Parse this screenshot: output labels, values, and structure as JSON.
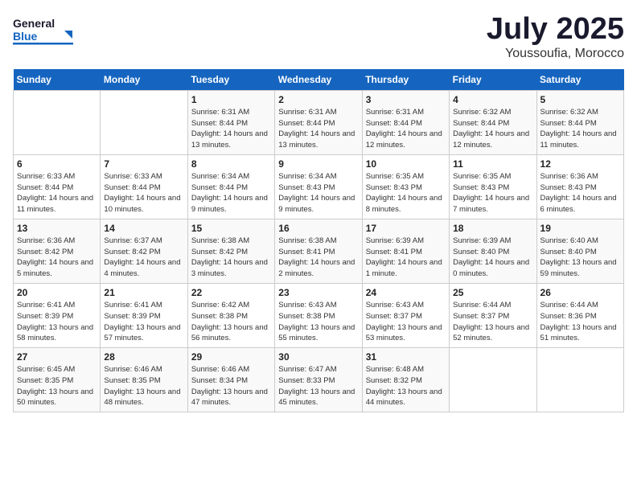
{
  "header": {
    "logo_general": "General",
    "logo_blue": "Blue",
    "month": "July 2025",
    "location": "Youssoufia, Morocco"
  },
  "days_of_week": [
    "Sunday",
    "Monday",
    "Tuesday",
    "Wednesday",
    "Thursday",
    "Friday",
    "Saturday"
  ],
  "weeks": [
    [
      {
        "day": "",
        "sunrise": "",
        "sunset": "",
        "daylight": ""
      },
      {
        "day": "",
        "sunrise": "",
        "sunset": "",
        "daylight": ""
      },
      {
        "day": "1",
        "sunrise": "Sunrise: 6:31 AM",
        "sunset": "Sunset: 8:44 PM",
        "daylight": "Daylight: 14 hours and 13 minutes."
      },
      {
        "day": "2",
        "sunrise": "Sunrise: 6:31 AM",
        "sunset": "Sunset: 8:44 PM",
        "daylight": "Daylight: 14 hours and 13 minutes."
      },
      {
        "day": "3",
        "sunrise": "Sunrise: 6:31 AM",
        "sunset": "Sunset: 8:44 PM",
        "daylight": "Daylight: 14 hours and 12 minutes."
      },
      {
        "day": "4",
        "sunrise": "Sunrise: 6:32 AM",
        "sunset": "Sunset: 8:44 PM",
        "daylight": "Daylight: 14 hours and 12 minutes."
      },
      {
        "day": "5",
        "sunrise": "Sunrise: 6:32 AM",
        "sunset": "Sunset: 8:44 PM",
        "daylight": "Daylight: 14 hours and 11 minutes."
      }
    ],
    [
      {
        "day": "6",
        "sunrise": "Sunrise: 6:33 AM",
        "sunset": "Sunset: 8:44 PM",
        "daylight": "Daylight: 14 hours and 11 minutes."
      },
      {
        "day": "7",
        "sunrise": "Sunrise: 6:33 AM",
        "sunset": "Sunset: 8:44 PM",
        "daylight": "Daylight: 14 hours and 10 minutes."
      },
      {
        "day": "8",
        "sunrise": "Sunrise: 6:34 AM",
        "sunset": "Sunset: 8:44 PM",
        "daylight": "Daylight: 14 hours and 9 minutes."
      },
      {
        "day": "9",
        "sunrise": "Sunrise: 6:34 AM",
        "sunset": "Sunset: 8:43 PM",
        "daylight": "Daylight: 14 hours and 9 minutes."
      },
      {
        "day": "10",
        "sunrise": "Sunrise: 6:35 AM",
        "sunset": "Sunset: 8:43 PM",
        "daylight": "Daylight: 14 hours and 8 minutes."
      },
      {
        "day": "11",
        "sunrise": "Sunrise: 6:35 AM",
        "sunset": "Sunset: 8:43 PM",
        "daylight": "Daylight: 14 hours and 7 minutes."
      },
      {
        "day": "12",
        "sunrise": "Sunrise: 6:36 AM",
        "sunset": "Sunset: 8:43 PM",
        "daylight": "Daylight: 14 hours and 6 minutes."
      }
    ],
    [
      {
        "day": "13",
        "sunrise": "Sunrise: 6:36 AM",
        "sunset": "Sunset: 8:42 PM",
        "daylight": "Daylight: 14 hours and 5 minutes."
      },
      {
        "day": "14",
        "sunrise": "Sunrise: 6:37 AM",
        "sunset": "Sunset: 8:42 PM",
        "daylight": "Daylight: 14 hours and 4 minutes."
      },
      {
        "day": "15",
        "sunrise": "Sunrise: 6:38 AM",
        "sunset": "Sunset: 8:42 PM",
        "daylight": "Daylight: 14 hours and 3 minutes."
      },
      {
        "day": "16",
        "sunrise": "Sunrise: 6:38 AM",
        "sunset": "Sunset: 8:41 PM",
        "daylight": "Daylight: 14 hours and 2 minutes."
      },
      {
        "day": "17",
        "sunrise": "Sunrise: 6:39 AM",
        "sunset": "Sunset: 8:41 PM",
        "daylight": "Daylight: 14 hours and 1 minute."
      },
      {
        "day": "18",
        "sunrise": "Sunrise: 6:39 AM",
        "sunset": "Sunset: 8:40 PM",
        "daylight": "Daylight: 14 hours and 0 minutes."
      },
      {
        "day": "19",
        "sunrise": "Sunrise: 6:40 AM",
        "sunset": "Sunset: 8:40 PM",
        "daylight": "Daylight: 13 hours and 59 minutes."
      }
    ],
    [
      {
        "day": "20",
        "sunrise": "Sunrise: 6:41 AM",
        "sunset": "Sunset: 8:39 PM",
        "daylight": "Daylight: 13 hours and 58 minutes."
      },
      {
        "day": "21",
        "sunrise": "Sunrise: 6:41 AM",
        "sunset": "Sunset: 8:39 PM",
        "daylight": "Daylight: 13 hours and 57 minutes."
      },
      {
        "day": "22",
        "sunrise": "Sunrise: 6:42 AM",
        "sunset": "Sunset: 8:38 PM",
        "daylight": "Daylight: 13 hours and 56 minutes."
      },
      {
        "day": "23",
        "sunrise": "Sunrise: 6:43 AM",
        "sunset": "Sunset: 8:38 PM",
        "daylight": "Daylight: 13 hours and 55 minutes."
      },
      {
        "day": "24",
        "sunrise": "Sunrise: 6:43 AM",
        "sunset": "Sunset: 8:37 PM",
        "daylight": "Daylight: 13 hours and 53 minutes."
      },
      {
        "day": "25",
        "sunrise": "Sunrise: 6:44 AM",
        "sunset": "Sunset: 8:37 PM",
        "daylight": "Daylight: 13 hours and 52 minutes."
      },
      {
        "day": "26",
        "sunrise": "Sunrise: 6:44 AM",
        "sunset": "Sunset: 8:36 PM",
        "daylight": "Daylight: 13 hours and 51 minutes."
      }
    ],
    [
      {
        "day": "27",
        "sunrise": "Sunrise: 6:45 AM",
        "sunset": "Sunset: 8:35 PM",
        "daylight": "Daylight: 13 hours and 50 minutes."
      },
      {
        "day": "28",
        "sunrise": "Sunrise: 6:46 AM",
        "sunset": "Sunset: 8:35 PM",
        "daylight": "Daylight: 13 hours and 48 minutes."
      },
      {
        "day": "29",
        "sunrise": "Sunrise: 6:46 AM",
        "sunset": "Sunset: 8:34 PM",
        "daylight": "Daylight: 13 hours and 47 minutes."
      },
      {
        "day": "30",
        "sunrise": "Sunrise: 6:47 AM",
        "sunset": "Sunset: 8:33 PM",
        "daylight": "Daylight: 13 hours and 45 minutes."
      },
      {
        "day": "31",
        "sunrise": "Sunrise: 6:48 AM",
        "sunset": "Sunset: 8:32 PM",
        "daylight": "Daylight: 13 hours and 44 minutes."
      },
      {
        "day": "",
        "sunrise": "",
        "sunset": "",
        "daylight": ""
      },
      {
        "day": "",
        "sunrise": "",
        "sunset": "",
        "daylight": ""
      }
    ]
  ]
}
